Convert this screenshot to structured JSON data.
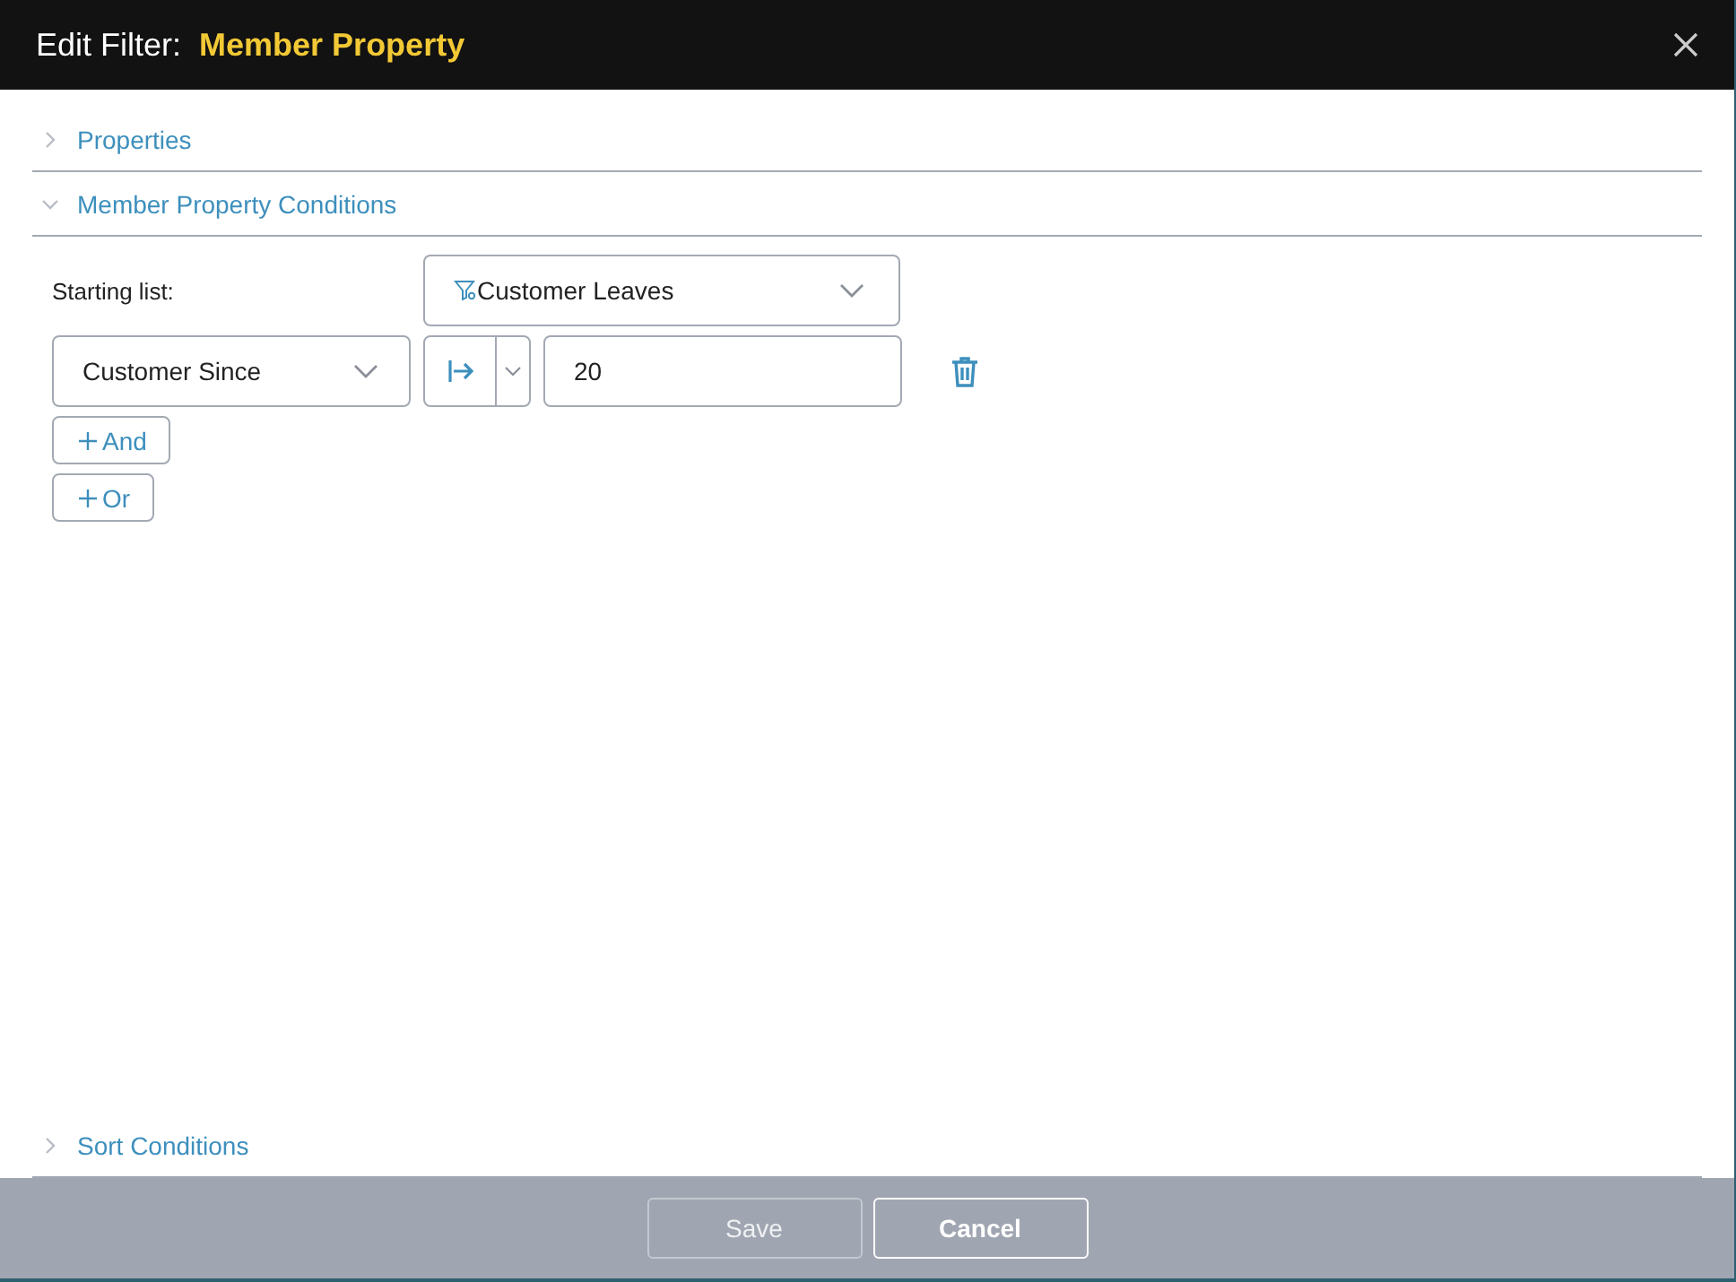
{
  "window": {
    "title": "Edit Filter:",
    "subtitle": "Member Property"
  },
  "sections": [
    {
      "label": "Properties",
      "expanded": false
    },
    {
      "label": "Member Property Conditions",
      "expanded": true
    },
    {
      "label": "Sort Conditions",
      "expanded": false
    }
  ],
  "starting_list": {
    "label": "Starting list:",
    "value": "Customer Leaves"
  },
  "condition": {
    "property": "Customer Since",
    "value": "20"
  },
  "add_buttons": [
    {
      "label": "And"
    },
    {
      "label": "Or"
    }
  ],
  "buttons": [
    {
      "label": "Save",
      "disabled": true
    },
    {
      "label": "Cancel",
      "disabled": false
    }
  ]
}
